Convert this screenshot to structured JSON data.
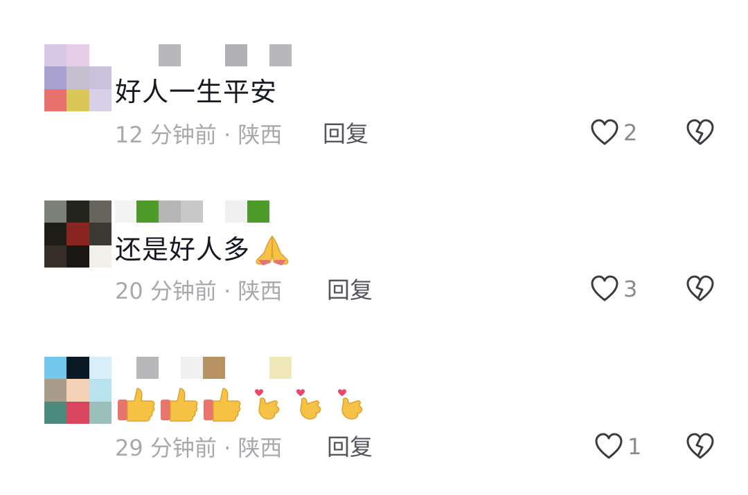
{
  "comments": [
    {
      "text": "好人一生平安",
      "time": "12 分钟前",
      "separator": "·",
      "location": "陕西",
      "reply_label": "回复",
      "like_count": "2",
      "avatar_colors": [
        "#d8c8e6",
        "#e8cde6",
        "#ffffff",
        "#a9a1cf",
        "#c3bfce",
        "#c9c1dd",
        "#e7716c",
        "#dbc659",
        "#d8cfe8"
      ],
      "username_colors": [
        "#ffffff",
        "#ffffff",
        "#b8b8bc",
        "#ffffff",
        "#ffffff",
        "#b0b0b4",
        "#ffffff",
        "#b8b8bc"
      ]
    },
    {
      "text": "还是好人多",
      "time": "20 分钟前",
      "separator": "·",
      "location": "陕西",
      "reply_label": "回复",
      "like_count": "3",
      "avatar_colors": [
        "#7e8177",
        "#252520",
        "#66665c",
        "#1f1d18",
        "#8a2622",
        "#3a3a33",
        "#362f28",
        "#1a1815",
        "#f1f0ea"
      ],
      "username_colors": [
        "#f4f4f4",
        "#4f9b2a",
        "#b5b5b5",
        "#c8c8c8",
        "#ffffff",
        "#f0f0f0",
        "#4f9b2a"
      ]
    },
    {
      "time": "29 分钟前",
      "separator": "·",
      "location": "陕西",
      "reply_label": "回复",
      "like_count": "1",
      "avatar_colors": [
        "#73c8ee",
        "#0c1a26",
        "#d8eef9",
        "#a99c8d",
        "#f5d1b6",
        "#b8e3ee",
        "#4c8a7d",
        "#d9445f",
        "#9bbfbb"
      ],
      "username_colors": [
        "#ffffff",
        "#b8b8bb",
        "#ffffff",
        "#f0f0f0",
        "#b79363",
        "#ffffff",
        "#ffffff",
        "#efe7b7"
      ]
    }
  ]
}
